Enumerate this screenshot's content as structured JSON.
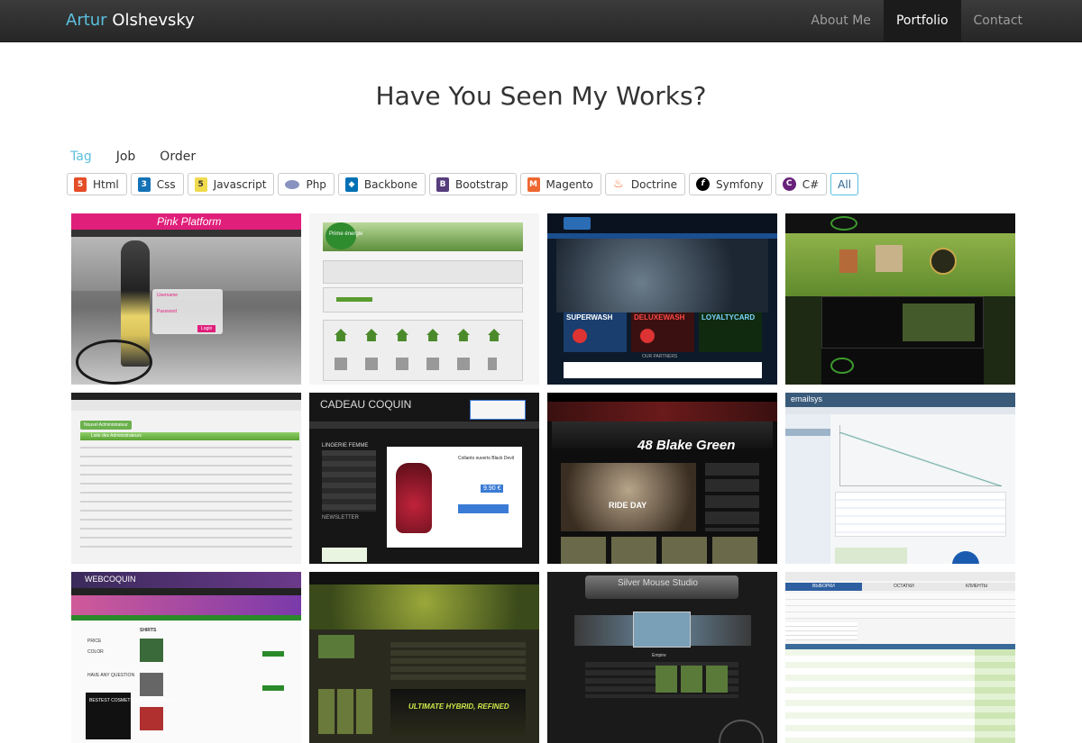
{
  "header": {
    "brand_first": "Artur",
    "brand_last": "Olshevsky",
    "nav": [
      {
        "label": "About Me",
        "active": false
      },
      {
        "label": "Portfolio",
        "active": true
      },
      {
        "label": "Contact",
        "active": false
      }
    ]
  },
  "main": {
    "title": "Have You Seen My Works?",
    "filter_tabs": [
      {
        "label": "Tag",
        "active": true
      },
      {
        "label": "Job",
        "active": false
      },
      {
        "label": "Order",
        "active": false
      }
    ],
    "tags": [
      {
        "label": "Html",
        "icon": "html5-icon"
      },
      {
        "label": "Css",
        "icon": "css3-icon"
      },
      {
        "label": "Javascript",
        "icon": "javascript-icon"
      },
      {
        "label": "Php",
        "icon": "php-icon"
      },
      {
        "label": "Backbone",
        "icon": "backbone-icon"
      },
      {
        "label": "Bootstrap",
        "icon": "bootstrap-icon"
      },
      {
        "label": "Magento",
        "icon": "magento-icon"
      },
      {
        "label": "Doctrine",
        "icon": "doctrine-icon"
      },
      {
        "label": "Symfony",
        "icon": "symfony-icon"
      },
      {
        "label": "C#",
        "icon": "csharp-icon"
      },
      {
        "label": "All",
        "icon": ""
      }
    ],
    "works": {
      "pink_platform": {
        "title": "Pink Platform",
        "login_label": "Username",
        "password_label": "Password",
        "button": "Login"
      },
      "prime_energie": {
        "logo": "Prime énergie"
      },
      "shine_expert": {
        "promo1": "SUPERWASH",
        "promo2": "DELUXEWASH",
        "promo3": "LOYALTYCARD",
        "partners": "OUR PARTNERS"
      },
      "game_site": {},
      "admin_list": {
        "button": "Nouvel Administrateur",
        "header": "Liste des Administrateurs"
      },
      "cadeau_coquin": {
        "logo": "CADEAU COQUIN",
        "section": "LINGERIE FEMME",
        "newsletter": "NEWSLETTER",
        "product": "Collants ouverts Black Devil",
        "price": "9.90 €"
      },
      "moto_site": {
        "headline": "48 Blake Green",
        "banner": "RIDE DAY"
      },
      "emailsys": {
        "logo": "emailsys"
      },
      "webcoquin": {
        "logo": "WEBCOQUIN",
        "section": "SHIRTS",
        "side_label": "PRICE",
        "color_label": "COLOR",
        "side_q": "HAVE ANY QUESTION",
        "bestest": "BESTEST COSMETICS IN THE WORLD!"
      },
      "bike_community": {
        "banner": "ULTIMATE HYBRID, REFINED"
      },
      "silver_mouse": {
        "title": "Silver Mouse Studio",
        "caption": "Empire"
      },
      "data_table": {
        "tab1": "ВЫБОРКИ",
        "tab2": "ОСТАТКИ",
        "tab3": "КЛИЕНТЫ"
      }
    }
  },
  "colors": {
    "accent": "#5bc0de",
    "navbar": "#2f2f2f",
    "pink": "#e01f7b"
  }
}
